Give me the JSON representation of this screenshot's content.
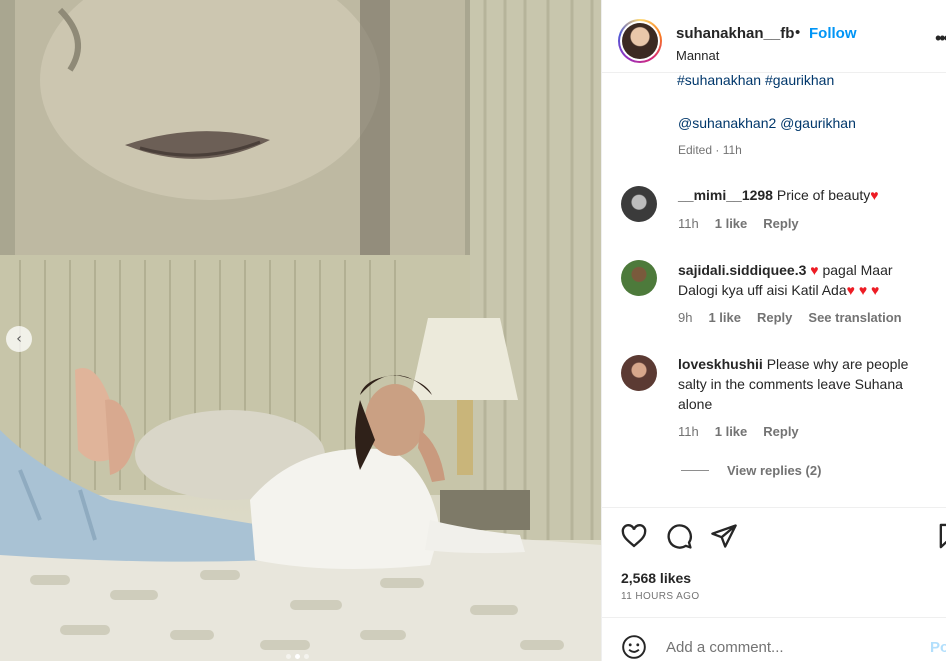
{
  "post": {
    "username": "suhanakhan__fb",
    "separator": "•",
    "follow_label": "Follow",
    "location": "Mannat",
    "more_label": "•••"
  },
  "caption": {
    "hashtags": "#suhanakhan #gaurikhan",
    "mentions": "@suhanakhan2 @gaurikhan",
    "edited": "Edited · 11h"
  },
  "comments": [
    {
      "user": "__mimi__1298",
      "text": "Price of beauty",
      "time": "11h",
      "likes": "1 like",
      "reply": "Reply"
    },
    {
      "user": "sajidali.siddiquee.3",
      "text": "pagal Maar Dalogi kya uff aisi Katil Ada",
      "time": "9h",
      "likes": "1 like",
      "reply": "Reply",
      "translate": "See translation"
    },
    {
      "user": "loveskhushii",
      "text": "Please why are people salty in the comments leave Suhana alone",
      "time": "11h",
      "likes": "1 like",
      "reply": "Reply"
    }
  ],
  "view_replies": "View replies (2)",
  "stats": {
    "likes": "2,568 likes",
    "time": "11 HOURS AGO"
  },
  "add_comment": {
    "placeholder": "Add a comment...",
    "post_label": "Post"
  },
  "carousel": {
    "prev_glyph": "‹"
  },
  "icons": {
    "like": "heart-icon",
    "comment": "comment-icon",
    "share": "paper-plane-icon",
    "save": "bookmark-icon",
    "emoji": "smiley-icon",
    "heart_color": "#ed1c24"
  },
  "colors": {
    "link": "#0095f6",
    "hashtag": "#00376b",
    "muted": "#737373"
  }
}
